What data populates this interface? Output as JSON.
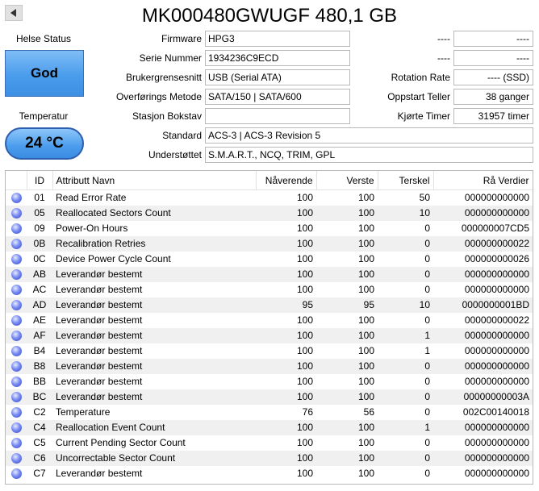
{
  "title": "MK000480GWUGF 480,1 GB",
  "status": {
    "health_label": "Helse Status",
    "health_value": "God",
    "temp_label": "Temperatur",
    "temp_value": "24 °C",
    "health_color": "#4a9cec"
  },
  "info_left": [
    {
      "label": "Firmware",
      "value": "HPG3"
    },
    {
      "label": "Serie Nummer",
      "value": "1934236C9ECD"
    },
    {
      "label": "Brukergrensesnitt",
      "value": "USB (Serial ATA)"
    },
    {
      "label": "Overførings Metode",
      "value": "SATA/150 | SATA/600"
    },
    {
      "label": "Stasjon Bokstav",
      "value": ""
    }
  ],
  "info_right": [
    {
      "label": "----",
      "value": "----"
    },
    {
      "label": "----",
      "value": "----"
    },
    {
      "label": "Rotation Rate",
      "value": "---- (SSD)"
    },
    {
      "label": "Oppstart Teller",
      "value": "38 ganger"
    },
    {
      "label": "Kjørte Timer",
      "value": "31957 timer"
    }
  ],
  "info_full": [
    {
      "label": "Standard",
      "value": "ACS-3 | ACS-3 Revision 5"
    },
    {
      "label": "Understøttet",
      "value": "S.M.A.R.T., NCQ, TRIM, GPL"
    }
  ],
  "table": {
    "headers": [
      "",
      "ID",
      "Attributt Navn",
      "Nåverende",
      "Verste",
      "Terskel",
      "Rå Verdier"
    ],
    "rows": [
      [
        "01",
        "Read Error Rate",
        "100",
        "100",
        "50",
        "000000000000"
      ],
      [
        "05",
        "Reallocated Sectors Count",
        "100",
        "100",
        "10",
        "000000000000"
      ],
      [
        "09",
        "Power-On Hours",
        "100",
        "100",
        "0",
        "000000007CD5"
      ],
      [
        "0B",
        "Recalibration Retries",
        "100",
        "100",
        "0",
        "000000000022"
      ],
      [
        "0C",
        "Device Power Cycle Count",
        "100",
        "100",
        "0",
        "000000000026"
      ],
      [
        "AB",
        "Leverandør bestemt",
        "100",
        "100",
        "0",
        "000000000000"
      ],
      [
        "AC",
        "Leverandør bestemt",
        "100",
        "100",
        "0",
        "000000000000"
      ],
      [
        "AD",
        "Leverandør bestemt",
        "95",
        "95",
        "10",
        "0000000001BD"
      ],
      [
        "AE",
        "Leverandør bestemt",
        "100",
        "100",
        "0",
        "000000000022"
      ],
      [
        "AF",
        "Leverandør bestemt",
        "100",
        "100",
        "1",
        "000000000000"
      ],
      [
        "B4",
        "Leverandør bestemt",
        "100",
        "100",
        "1",
        "000000000000"
      ],
      [
        "B8",
        "Leverandør bestemt",
        "100",
        "100",
        "0",
        "000000000000"
      ],
      [
        "BB",
        "Leverandør bestemt",
        "100",
        "100",
        "0",
        "000000000000"
      ],
      [
        "BC",
        "Leverandør bestemt",
        "100",
        "100",
        "0",
        "00000000003A"
      ],
      [
        "C2",
        "Temperature",
        "76",
        "56",
        "0",
        "002C00140018"
      ],
      [
        "C4",
        "Reallocation Event Count",
        "100",
        "100",
        "1",
        "000000000000"
      ],
      [
        "C5",
        "Current Pending Sector Count",
        "100",
        "100",
        "0",
        "000000000000"
      ],
      [
        "C6",
        "Uncorrectable Sector Count",
        "100",
        "100",
        "0",
        "000000000000"
      ],
      [
        "C7",
        "Leverandør bestemt",
        "100",
        "100",
        "0",
        "000000000000"
      ]
    ]
  }
}
